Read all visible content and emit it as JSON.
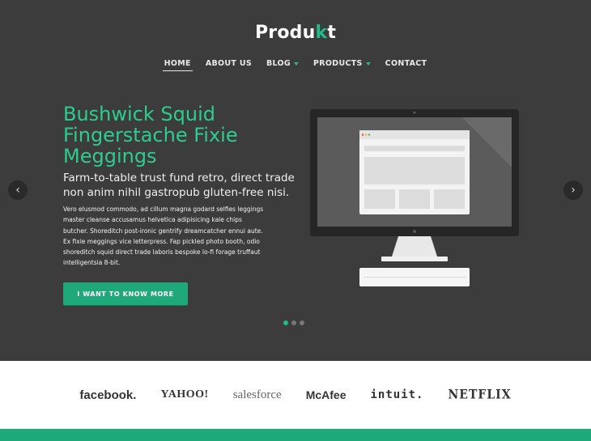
{
  "brand": {
    "logo_prefix": "Produ",
    "logo_accent": "k",
    "logo_suffix": "t"
  },
  "nav": [
    {
      "label": "HOME",
      "active": true,
      "dropdown": false
    },
    {
      "label": "ABOUT US",
      "active": false,
      "dropdown": false
    },
    {
      "label": "BLOG",
      "active": false,
      "dropdown": true
    },
    {
      "label": "PRODUCTS",
      "active": false,
      "dropdown": true
    },
    {
      "label": "CONTACT",
      "active": false,
      "dropdown": false
    }
  ],
  "hero": {
    "title": "Bushwick Squid Fingerstache Fixie Meggings",
    "subtitle": "Farm-to-table trust fund retro, direct trade non anim nihil gastropub gluten-free nisi.",
    "body": "Vero elusmod commodo, ad cillum magna godard selfies leggings master cleanse accusamus helvetica adipisicing kale chips butcher. Shoreditch post-ironic gentrify dreamcatcher ennui aute. Ex fixie meggings vice letterpress. Fap pickled photo booth, odio shoreditch squid direct trade laboris bespoke lo-fi forage truffaut intelligentsia 8-bit.",
    "cta": "I WANT TO KNOW MORE",
    "prev_icon": "chevron-left-icon",
    "next_icon": "chevron-right-icon",
    "slides_total": 3,
    "active_slide": 1
  },
  "partners": [
    {
      "name": "facebook.",
      "class": "b-facebook"
    },
    {
      "name": "YAHOO!",
      "class": "b-yahoo"
    },
    {
      "name": "salesforce",
      "class": "b-salesforce"
    },
    {
      "name": "McAfee",
      "class": "b-mcafee"
    },
    {
      "name": "intuit.",
      "class": "b-intuit"
    },
    {
      "name": "NETFLIX",
      "class": "b-netflix"
    }
  ],
  "colors": {
    "accent": "#1fbd8a",
    "hero_bg": "#3c3c3c",
    "button": "#1fa87a"
  }
}
